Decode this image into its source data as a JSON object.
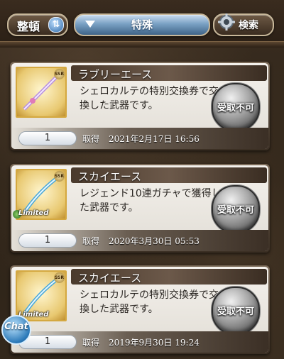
{
  "toolbar": {
    "sort_label": "整頓",
    "filter_label": "特殊",
    "search_label": "検索"
  },
  "items": [
    {
      "name": "ラブリーエース",
      "description": "シェロカルテの特別交換券で交換した武器です。",
      "status": "受取不可",
      "quantity": "1",
      "acquired_label": "取得",
      "acquired_date": "2021年2月17日 16:56",
      "limited": false
    },
    {
      "name": "スカイエース",
      "description": "レジェンド10連ガチャで獲得した武器です。",
      "status": "受取不可",
      "quantity": "1",
      "acquired_label": "取得",
      "acquired_date": "2020年3月30日 05:53",
      "limited": true,
      "limited_label": "Limited"
    },
    {
      "name": "スカイエース",
      "description": "シェロカルテの特別交換券で交換した武器です。",
      "status": "受取不可",
      "quantity": "1",
      "acquired_label": "取得",
      "acquired_date": "2019年9月30日 19:24",
      "limited": true,
      "limited_label": "Limited"
    }
  ],
  "chat": {
    "label": "Chat"
  },
  "colors": {
    "filter_blue": "#7aa1c4",
    "card_bg": "#f4f1ec",
    "name_bar": "#4a3a2c"
  }
}
